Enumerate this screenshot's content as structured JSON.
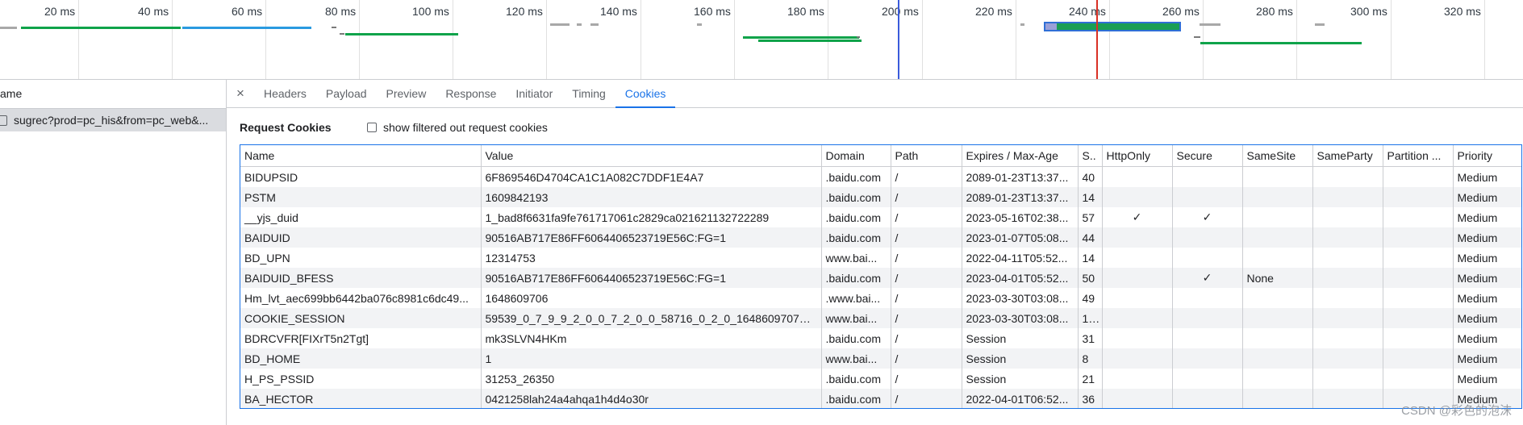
{
  "timeline": {
    "tick_labels": [
      "20 ms",
      "40 ms",
      "60 ms",
      "80 ms",
      "100 ms",
      "120 ms",
      "140 ms",
      "160 ms",
      "180 ms",
      "200 ms",
      "220 ms",
      "240 ms",
      "260 ms",
      "280 ms",
      "300 ms",
      "320 ms"
    ]
  },
  "requests": {
    "header": "ame",
    "items": [
      {
        "name": "sugrec?prod=pc_his&from=pc_web&..."
      }
    ]
  },
  "tabs": {
    "close_label": "×",
    "items": [
      "Headers",
      "Payload",
      "Preview",
      "Response",
      "Initiator",
      "Timing",
      "Cookies"
    ],
    "active": "Cookies"
  },
  "cookies": {
    "section_title": "Request Cookies",
    "filter_label": "show filtered out request cookies",
    "columns": [
      "Name",
      "Value",
      "Domain",
      "Path",
      "Expires / Max-Age",
      "S..",
      "HttpOnly",
      "Secure",
      "SameSite",
      "SameParty",
      "Partition ...",
      "Priority"
    ],
    "rows": [
      [
        "BIDUPSID",
        "6F869546D4704CA1C1A082C7DDF1E4A7",
        ".baidu.com",
        "/",
        "2089-01-23T13:37...",
        "40",
        "",
        "",
        "",
        "",
        "",
        "Medium"
      ],
      [
        "PSTM",
        "1609842193",
        ".baidu.com",
        "/",
        "2089-01-23T13:37...",
        "14",
        "",
        "",
        "",
        "",
        "",
        "Medium"
      ],
      [
        "__yjs_duid",
        "1_bad8f6631fa9fe761717061c2829ca021621132722289",
        ".baidu.com",
        "/",
        "2023-05-16T02:38...",
        "57",
        "✓",
        "✓",
        "",
        "",
        "",
        "Medium"
      ],
      [
        "BAIDUID",
        "90516AB717E86FF6064406523719E56C:FG=1",
        ".baidu.com",
        "/",
        "2023-01-07T05:08...",
        "44",
        "",
        "",
        "",
        "",
        "",
        "Medium"
      ],
      [
        "BD_UPN",
        "12314753",
        "www.bai...",
        "/",
        "2022-04-11T05:52...",
        "14",
        "",
        "",
        "",
        "",
        "",
        "Medium"
      ],
      [
        "BAIDUID_BFESS",
        "90516AB717E86FF6064406523719E56C:FG=1",
        ".baidu.com",
        "/",
        "2023-04-01T05:52...",
        "50",
        "",
        "✓",
        "None",
        "",
        "",
        "Medium"
      ],
      [
        "Hm_lvt_aec699bb6442ba076c8981c6dc49...",
        "1648609706",
        ".www.bai...",
        "/",
        "2023-03-30T03:08...",
        "49",
        "",
        "",
        "",
        "",
        "",
        "Medium"
      ],
      [
        "COOKIE_SESSION",
        "59539_0_7_9_9_2_0_0_7_2_0_0_58716_0_2_0_1648609707_0_...",
        "www.bai...",
        "/",
        "2023-03-30T03:08...",
        "1...",
        "",
        "",
        "",
        "",
        "",
        "Medium"
      ],
      [
        "BDRCVFR[FIXrT5n2Tgt]",
        "mk3SLVN4HKm",
        ".baidu.com",
        "/",
        "Session",
        "31",
        "",
        "",
        "",
        "",
        "",
        "Medium"
      ],
      [
        "BD_HOME",
        "1",
        "www.bai...",
        "/",
        "Session",
        "8",
        "",
        "",
        "",
        "",
        "",
        "Medium"
      ],
      [
        "H_PS_PSSID",
        "31253_26350",
        ".baidu.com",
        "/",
        "Session",
        "21",
        "",
        "",
        "",
        "",
        "",
        "Medium"
      ],
      [
        "BA_HECTOR",
        "0421258lah24a4ahqa1h4d4o30r",
        ".baidu.com",
        "/",
        "2022-04-01T06:52...",
        "36",
        "",
        "",
        "",
        "",
        "",
        "Medium"
      ]
    ]
  },
  "watermark": "CSDN @彩色的泡沫"
}
